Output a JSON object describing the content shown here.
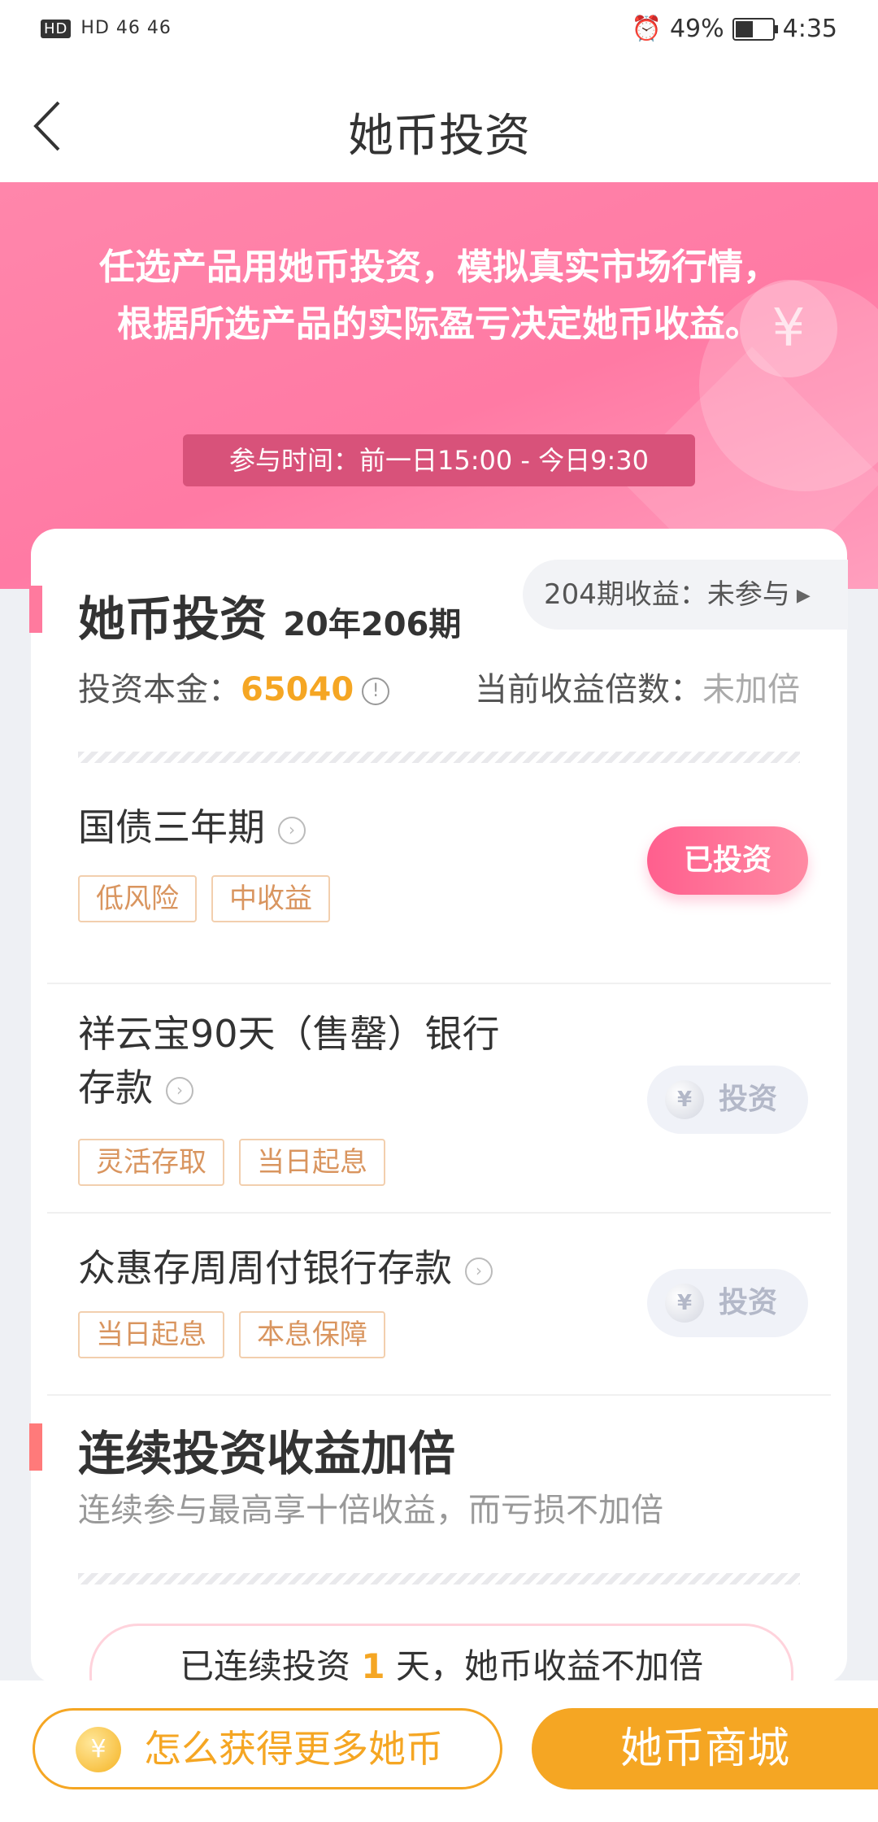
{
  "status_bar": {
    "left": "HD 46 46",
    "battery": "49%",
    "time": "4:35"
  },
  "header": {
    "title": "她币投资"
  },
  "banner": {
    "description": "任选产品用她币投资，模拟真实市场行情，根据所选产品的实际盈亏决定她币收益。",
    "time": "参与时间：前一日15:00 - 今日9:30"
  },
  "investment": {
    "title": "她币投资",
    "period": "20年206期",
    "prev_period": "204期收益：未参与",
    "principal_label": "投资本金：",
    "principal_value": "65040",
    "multiplier_label": "当前收益倍数：",
    "multiplier_value": "未加倍"
  },
  "products": [
    {
      "name": "国债三年期",
      "tags": [
        "低风险",
        "中收益"
      ],
      "button": "已投资"
    },
    {
      "name": "祥云宝90天（售罄）银行存款",
      "tags": [
        "灵活存取",
        "当日起息"
      ],
      "button": "投资"
    },
    {
      "name": "众惠存周周付银行存款",
      "tags": [
        "当日起息",
        "本息保障"
      ],
      "button": "投资"
    }
  ],
  "streak_section": {
    "title": "连续投资收益加倍",
    "subtitle": "连续参与最高享十倍收益，而亏损不加倍",
    "streak_prefix": "已连续投资",
    "streak_days": "1",
    "streak_suffix": "天，她币收益不加倍"
  },
  "bottom_bar": {
    "more_coins": "怎么获得更多她币",
    "mall": "她币商城"
  }
}
